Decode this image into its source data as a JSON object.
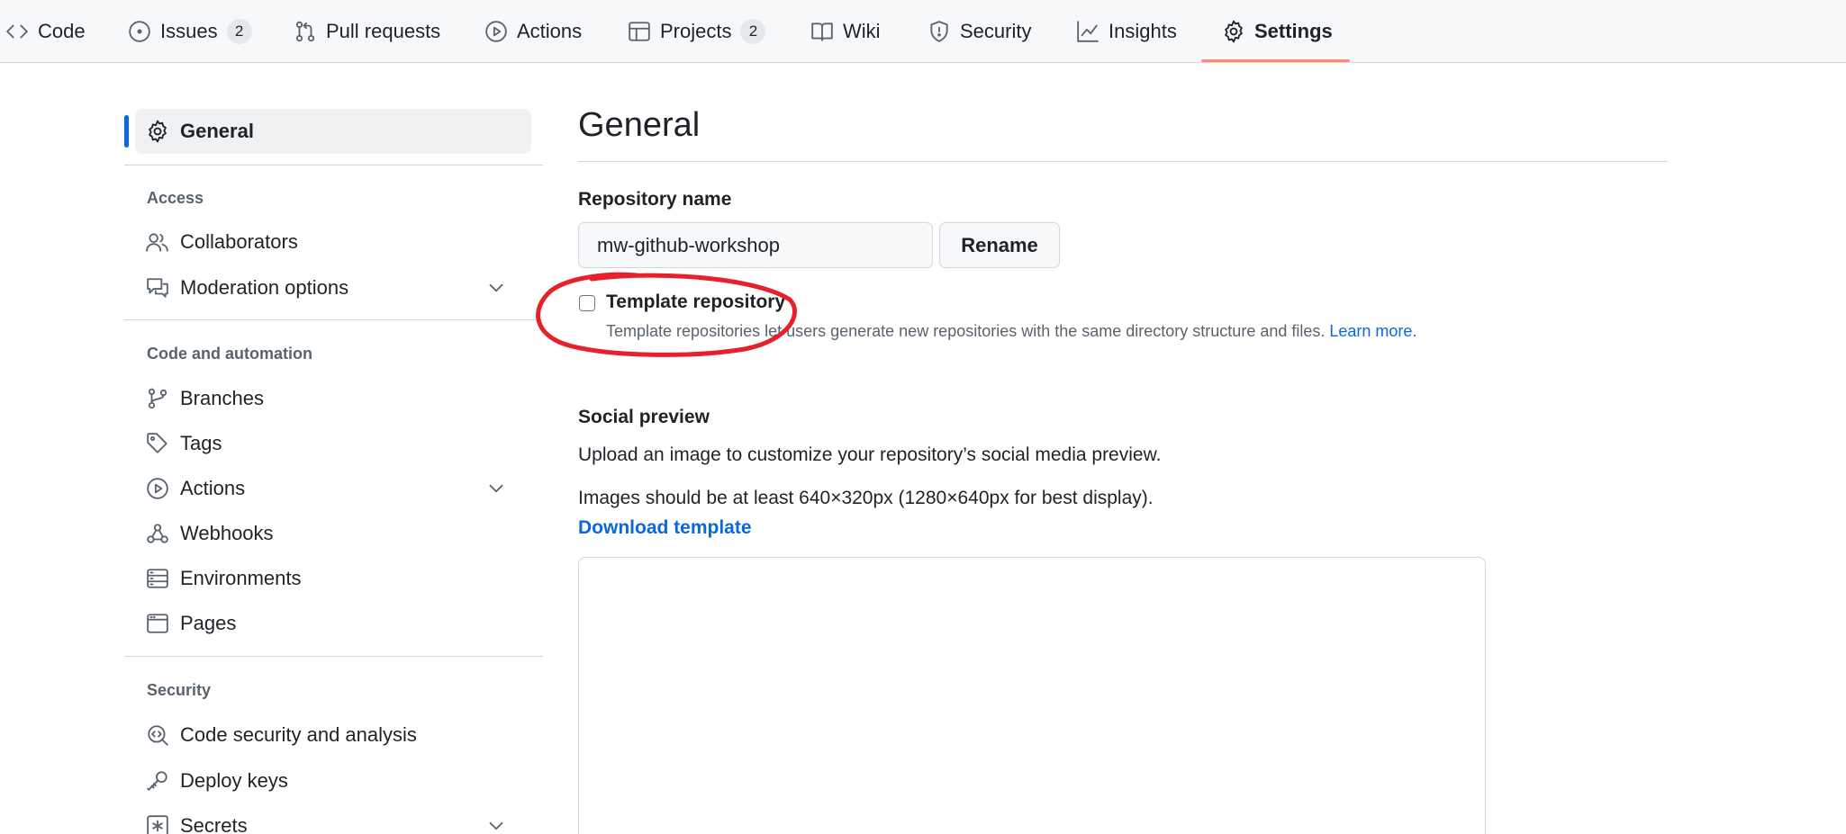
{
  "repo_nav": {
    "tabs": [
      {
        "label": "Code",
        "icon": "code-icon"
      },
      {
        "label": "Issues",
        "icon": "issue-opened-icon",
        "counter": "2"
      },
      {
        "label": "Pull requests",
        "icon": "git-pull-request-icon"
      },
      {
        "label": "Actions",
        "icon": "play-icon"
      },
      {
        "label": "Projects",
        "icon": "table-icon",
        "counter": "2"
      },
      {
        "label": "Wiki",
        "icon": "book-icon"
      },
      {
        "label": "Security",
        "icon": "shield-icon"
      },
      {
        "label": "Insights",
        "icon": "graph-icon"
      },
      {
        "label": "Settings",
        "icon": "gear-icon",
        "selected": true
      }
    ],
    "selected_underline_color": "#fd8c73"
  },
  "sidebar": {
    "general": {
      "label": "General",
      "icon": "gear-icon",
      "active": true
    },
    "sections": [
      {
        "heading": "Access",
        "items": [
          {
            "label": "Collaborators",
            "icon": "people-icon"
          },
          {
            "label": "Moderation options",
            "icon": "comment-discussion-icon",
            "expandable": true
          }
        ]
      },
      {
        "heading": "Code and automation",
        "items": [
          {
            "label": "Branches",
            "icon": "git-branch-icon"
          },
          {
            "label": "Tags",
            "icon": "tag-icon"
          },
          {
            "label": "Actions",
            "icon": "play-icon",
            "expandable": true
          },
          {
            "label": "Webhooks",
            "icon": "webhook-icon"
          },
          {
            "label": "Environments",
            "icon": "server-icon"
          },
          {
            "label": "Pages",
            "icon": "browser-icon"
          }
        ]
      },
      {
        "heading": "Security",
        "items": [
          {
            "label": "Code security and analysis",
            "icon": "codescan-icon"
          },
          {
            "label": "Deploy keys",
            "icon": "key-icon"
          },
          {
            "label": "Secrets",
            "icon": "key-asterisk-icon",
            "expandable": true
          }
        ]
      }
    ],
    "active_indicator_color": "#0969da"
  },
  "main": {
    "title": "General",
    "repo_name": {
      "label": "Repository name",
      "value": "mw-github-workshop",
      "rename_button": "Rename"
    },
    "template_repo": {
      "label": "Template repository",
      "checked": false,
      "description": "Template repositories let users generate new repositories with the same directory structure and files.",
      "learn_more": "Learn more."
    },
    "social_preview": {
      "heading": "Social preview",
      "intro": "Upload an image to customize your repository’s social media preview.",
      "requirements": "Images should be at least 640×320px (1280×640px for best display).",
      "download_link": "Download template"
    }
  },
  "annotation": {
    "color": "#e8202a",
    "shape": "hand-drawn-circle"
  }
}
